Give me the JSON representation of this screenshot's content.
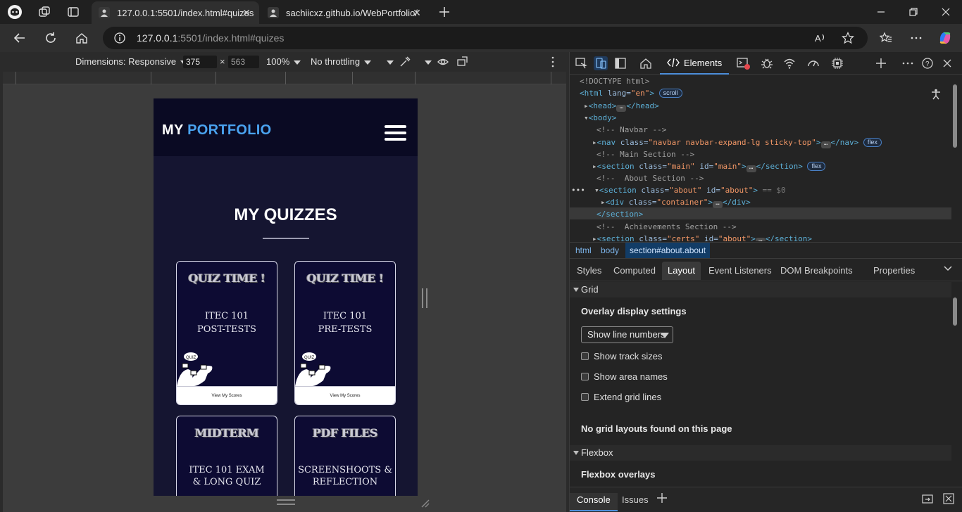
{
  "browser": {
    "tabs": [
      {
        "title": "127.0.0.1:5501/index.html#quizes",
        "active": true
      },
      {
        "title": "sachiicxz.github.io/WebPortfolio/",
        "active": false
      }
    ],
    "url_host": "127.0.0.1",
    "url_rest": ":5501/index.html#quizes",
    "accent": "#4c8ed9"
  },
  "device_toolbar": {
    "dimensions_label": "Dimensions: Responsive",
    "width": "375",
    "times": "×",
    "height": "563",
    "zoom": "100%",
    "throttling": "No throttling"
  },
  "site": {
    "brand_prefix": "MY",
    "brand_accent": "PORTFOLIO",
    "section_title": "MY QUIZZES",
    "cards": [
      {
        "title": "QUIZ TIME !",
        "line1": "ITEC 101",
        "line2": "POST-TESTS",
        "footer": "View My Scores"
      },
      {
        "title": "QUIZ TIME !",
        "line1": "ITEC 101",
        "line2": "PRE-TESTS",
        "footer": "View My Scores"
      },
      {
        "title": "MIDTERM",
        "line1": "ITEC 101 EXAM",
        "line2": "& LONG QUIZ",
        "footer": ""
      },
      {
        "title": "PDF FILES",
        "line1": "SCREENSHOOTS &",
        "line2": "REFLECTION",
        "footer": ""
      }
    ],
    "doodle_text": "QUIZ",
    "nav_bg": "#0a0a23",
    "page_bg": "#151531",
    "brand_accent_color": "#4aa3f0"
  },
  "devtools": {
    "elements_tab": "Elements",
    "dom": {
      "doctype": "<!DOCTYPE html>",
      "html_open": "<html",
      "html_lang_attr": " lang=",
      "html_lang_val": "\"en\"",
      "html_close_bracket": ">",
      "scroll_badge": "scroll",
      "head_open": "<head>",
      "head_close": "</head>",
      "body_open": "<body>",
      "c_navbar": "<!-- Navbar -->",
      "nav_open": "<nav",
      "nav_class_attr": " class=",
      "nav_class_val": "\"navbar navbar-expand-lg sticky-top\"",
      "nav_gt": ">",
      "nav_close": "</nav>",
      "flex_badge": "flex",
      "c_main": "<!-- Main Section -->",
      "sec_open": "<section",
      "cls_attr": " class=",
      "main_cls": "\"main\"",
      "id_attr": " id=",
      "main_id": "\"main\"",
      "gt": ">",
      "sec_close": "</section>",
      "c_about": "<!--  About Section -->",
      "about_cls": "\"about\"",
      "about_id": "\"about\"",
      "eq_ref": " == $0",
      "div_open": "<div",
      "container_cls": "\"container\"",
      "div_close": "</div>",
      "c_ach": "<!--  Achievements Section -->",
      "certs_cls": "\"certs\"",
      "certs_id": "\"about\""
    },
    "crumbs": [
      "html",
      "body",
      "section#about.about"
    ],
    "panel_tabs": [
      "Styles",
      "Computed",
      "Layout",
      "Event Listeners",
      "DOM Breakpoints",
      "Properties"
    ],
    "layout": {
      "grid_header": "Grid",
      "overlay_title": "Overlay display settings",
      "select_value": "Show line numbers",
      "checkboxes": [
        "Show track sizes",
        "Show area names",
        "Extend grid lines"
      ],
      "no_grid": "No grid layouts found on this page",
      "flex_header": "Flexbox",
      "flex_overlays": "Flexbox overlays"
    },
    "drawer_tabs": [
      "Console",
      "Issues"
    ]
  }
}
